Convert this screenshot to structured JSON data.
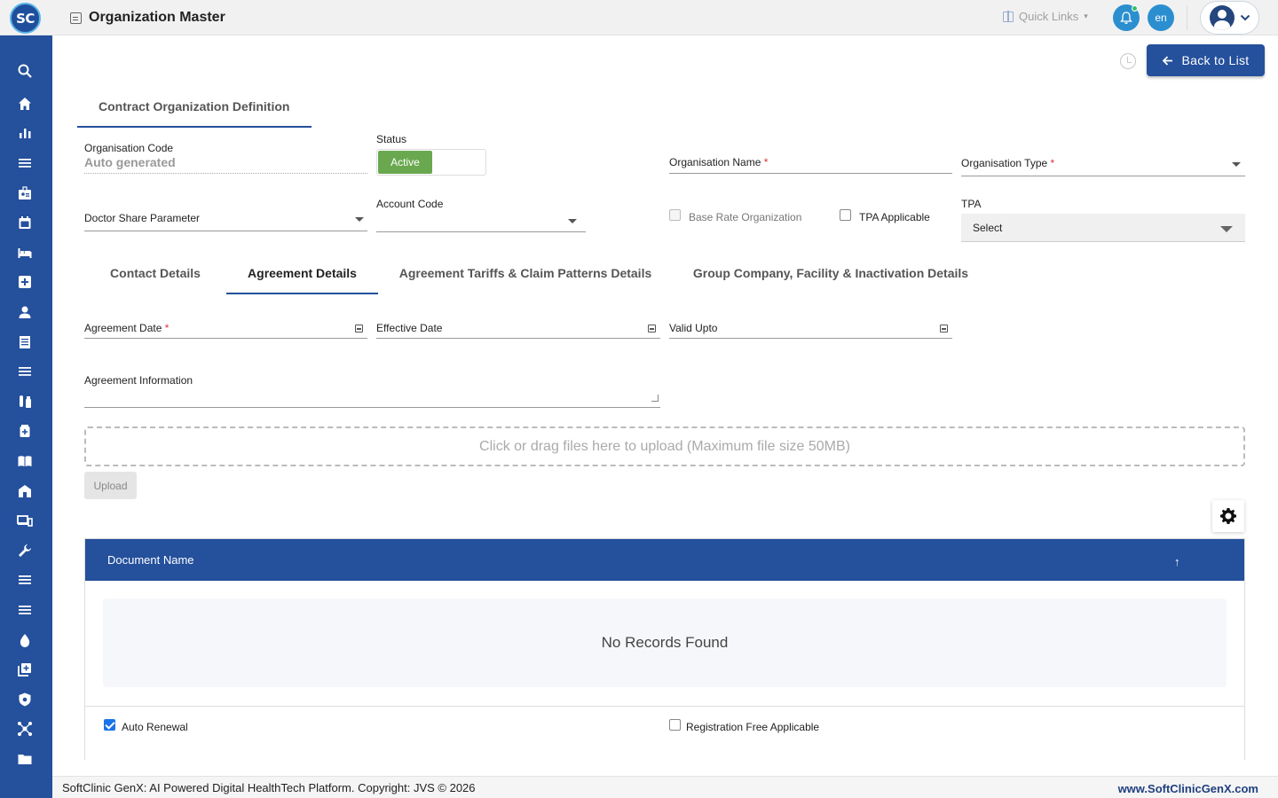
{
  "header": {
    "logo_left": "S",
    "logo_right": "C",
    "title": "Organization Master",
    "quick_links": "Quick Links",
    "lang": "en"
  },
  "sidebar": {
    "icons": [
      "search-icon",
      "home-icon",
      "bar-chart-icon",
      "menu-icon",
      "badge-icon",
      "calendar-icon",
      "bed-icon",
      "medical-plus-icon",
      "person-icon",
      "receipt-icon",
      "list-icon",
      "lab-icon",
      "medicine-box-icon",
      "book-icon",
      "building-icon",
      "devices-icon",
      "wrench-icon",
      "menu-icon",
      "menu-icon",
      "drop-icon",
      "add-box-icon",
      "shield-icon",
      "network-icon",
      "folder-icon"
    ]
  },
  "actions": {
    "back_to_list": "Back to List"
  },
  "main_tab": "Contract Organization Definition",
  "form": {
    "org_code_label": "Organisation Code",
    "org_code_value": "Auto generated",
    "status_label": "Status",
    "status_value": "Active",
    "org_name_label": "Organisation Name",
    "org_type_label": "Organisation Type",
    "required_mark": "*",
    "doctor_share_label": "Doctor Share Parameter",
    "account_code_label": "Account Code",
    "base_rate_label": "Base Rate Organization",
    "tpa_applicable_label": "TPA Applicable",
    "tpa_label": "TPA",
    "tpa_value": "Select"
  },
  "subtabs": [
    "Contact Details",
    "Agreement Details",
    "Agreement Tariffs & Claim Patterns Details",
    "Group Company, Facility & Inactivation Details"
  ],
  "agreement": {
    "agreement_date_label": "Agreement Date",
    "effective_date_label": "Effective Date",
    "valid_upto_label": "Valid Upto",
    "info_label": "Agreement Information",
    "dropzone_text": "Click or drag files here to upload (Maximum file size 50MB)",
    "upload_label": "Upload"
  },
  "grid": {
    "column": "Document Name",
    "sort_icon": "↑",
    "empty_text": "No Records Found"
  },
  "bottom": {
    "auto_renewal_label": "Auto Renewal",
    "auto_renewal_checked": true,
    "registration_free_label": "Registration Free Applicable",
    "registration_free_checked": false
  },
  "footer": {
    "left": "SoftClinic GenX: AI Powered Digital HealthTech Platform. Copyright: JVS © 2026",
    "right": "www.SoftClinicGenX.com"
  },
  "colors": {
    "primary": "#24509c",
    "active_green": "#6aa84f",
    "notify": "#2b8fcf"
  }
}
